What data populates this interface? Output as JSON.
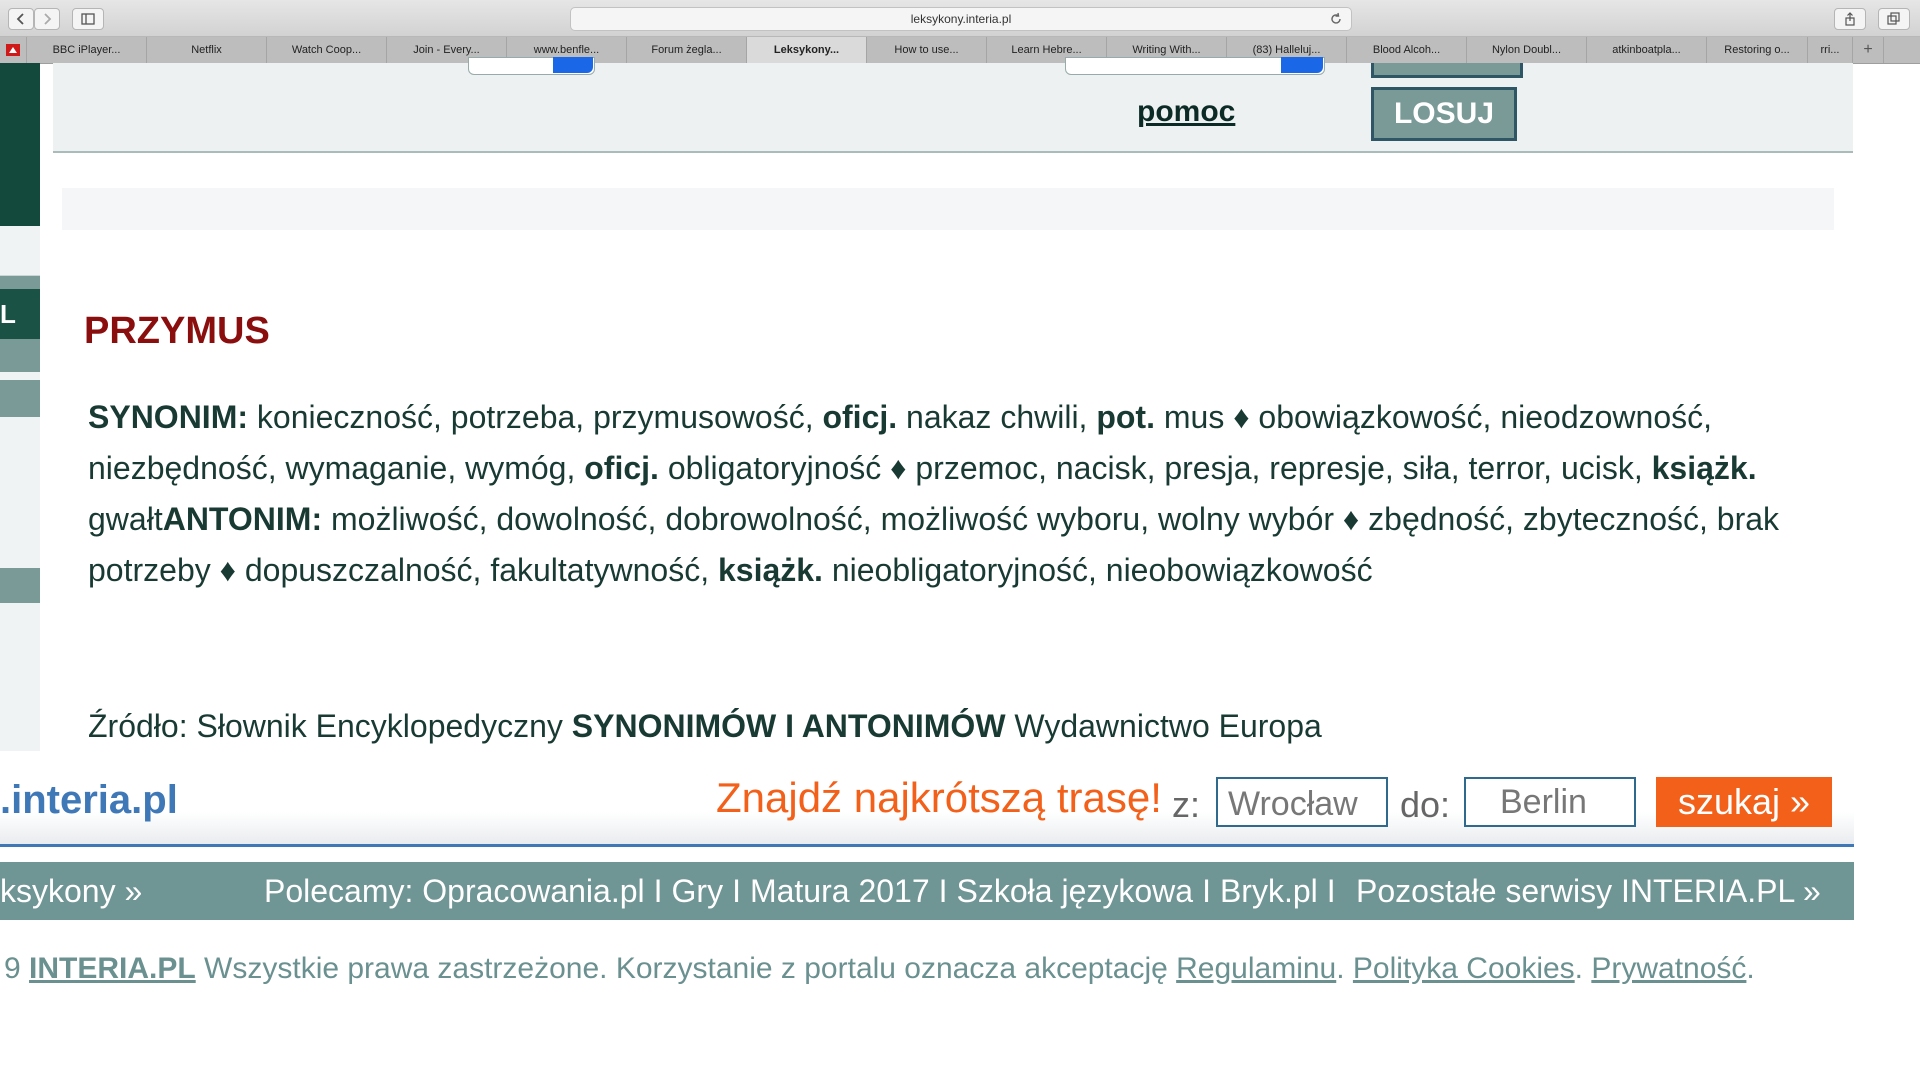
{
  "browser": {
    "address": "leksykony.interia.pl",
    "tabs": [
      "BBC iPlayer...",
      "Netflix",
      "Watch Coop...",
      "Join - Every...",
      "www.benfle...",
      "Forum żegla...",
      "Leksykony...",
      "How to use...",
      "Learn Hebre...",
      "Writing With...",
      "(83) Halleluj...",
      "Blood Alcoh...",
      "Nylon Doubl...",
      "atkinboatpla...",
      "Restoring o...",
      "rri..."
    ],
    "active_tab_index": 6,
    "plus": "+"
  },
  "left_strip": {
    "letter": "L"
  },
  "header": {
    "help_link": "pomoc",
    "random_button": "LOSUJ"
  },
  "entry": {
    "title": "PRZYMUS",
    "synonym_label": "SYNONIM:",
    "syn_part1": " konieczność, potrzeba, przymusowość, ",
    "oficj": "oficj.",
    "syn_part2": " nakaz chwili, ",
    "pot": "pot.",
    "syn_part3": " mus ♦ obowiązkowość, nieodzowność, niezbędność, wymaganie, wymóg, ",
    "syn_part4": " obligatoryjność ♦ przemoc, nacisk, presja, represje, siła, terror, ucisk, ",
    "ksiazk": "książk.",
    "syn_part5": " gwałt",
    "antonym_label": "ANTONIM:",
    "ant_part1": " możliwość, dowolność, dobrowolność, możliwość wyboru, wolny wybór ♦ zbędność, zbyteczność, brak potrzeby ♦ dopuszczalność, fakultatywność, ",
    "ant_part2": " nieobligatoryjność, nieobowiązkowość"
  },
  "source": {
    "label": "Źródło: Słownik Encyklopedyczny ",
    "bold": "SYNONIMÓW I ANTONIMÓW",
    "publisher": " Wydawnictwo Europa"
  },
  "routebar": {
    "logo": ".interia.pl",
    "prompt": "Znajdź najkrótszą trasę!",
    "from_label": "z:",
    "from_value": "Wrocław",
    "to_label": "do:",
    "to_value": "Berlin",
    "search_label": "szukaj »"
  },
  "footer_nav": {
    "left": "ksykony »",
    "recommend": "Polecamy: Opracowania.pl",
    "links": [
      "Gry",
      "Matura 2017",
      "Szkoła językowa",
      "Bryk.pl"
    ],
    "separator": "I",
    "right": "Pozostałe  serwisy INTERIA.PL »"
  },
  "copyright": {
    "prefix": "9 ",
    "brand": "INTERIA.PL",
    "text": " Wszystkie prawa zastrzeżone. Korzystanie z portalu oznacza akceptację ",
    "regulamin": "Regulaminu",
    "dot1": ". ",
    "cookies": "Polityka Cookies",
    "dot2": ". ",
    "privacy": "Prywatność",
    "dot3": "."
  },
  "colors": {
    "title_red": "#8b0e0e",
    "text_dark": "#193a33",
    "teal": "#6f9594",
    "orange": "#f2601a",
    "interia_blue": "#3f78b7"
  }
}
